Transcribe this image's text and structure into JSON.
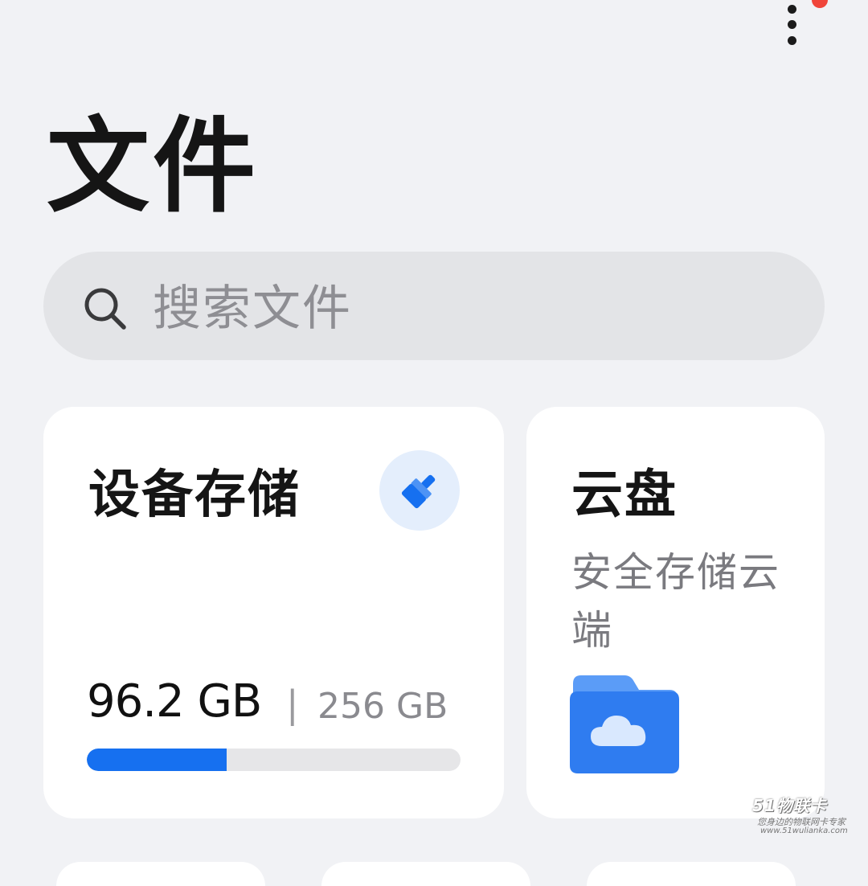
{
  "header": {
    "title": "文件",
    "menu_icon": "more-vertical-icon",
    "notification_color": "#f0453a"
  },
  "search": {
    "placeholder": "搜索文件",
    "icon": "search-icon"
  },
  "device_storage": {
    "title": "设备存储",
    "clean_icon": "broom-icon",
    "used": "96.2 GB",
    "separator": "|",
    "total": "256 GB",
    "used_fraction": 0.375,
    "accent_color": "#1670f0"
  },
  "cloud": {
    "title": "云盘",
    "subtitle": "安全存储云端",
    "icon": "cloud-folder-icon"
  },
  "watermark": {
    "logo": "51物联卡",
    "slogan": "您身边的物联网卡专家",
    "url": "www.51wulianka.com"
  }
}
